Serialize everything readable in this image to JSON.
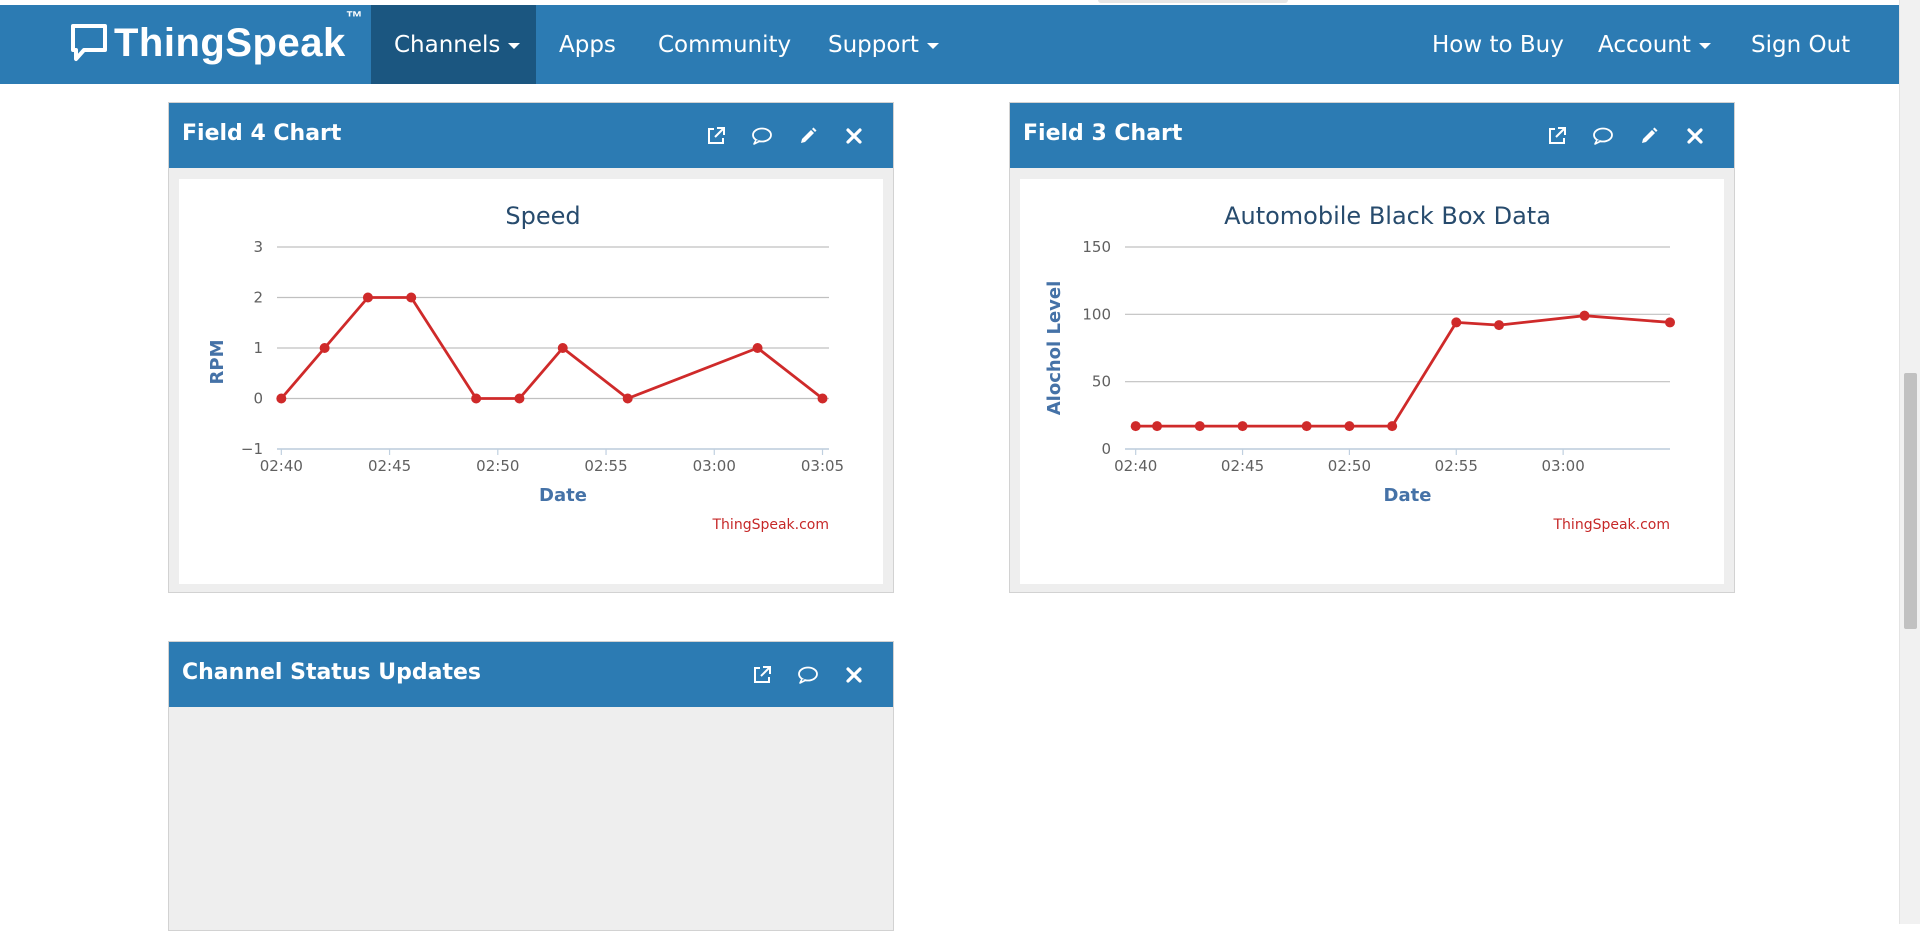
{
  "navbar": {
    "brand": "ThingSpeak",
    "brand_tm": "™",
    "items": [
      {
        "label": "Channels",
        "dropdown": true,
        "active": true
      },
      {
        "label": "Apps"
      },
      {
        "label": "Community"
      },
      {
        "label": "Support",
        "dropdown": true
      },
      {
        "label": "How to Buy"
      },
      {
        "label": "Account",
        "dropdown": true
      },
      {
        "label": "Sign Out"
      }
    ]
  },
  "panels": {
    "field4": {
      "title": "Field 4 Chart",
      "icons": [
        "external-link-icon",
        "comment-icon",
        "pencil-icon",
        "close-icon"
      ]
    },
    "field3": {
      "title": "Field 3 Chart",
      "icons": [
        "external-link-icon",
        "comment-icon",
        "pencil-icon",
        "close-icon"
      ]
    },
    "status": {
      "title": "Channel Status Updates",
      "icons": [
        "external-link-icon",
        "comment-icon",
        "close-icon"
      ]
    }
  },
  "colors": {
    "navbar": "#2c7bb3",
    "navbar_active": "#1b5680",
    "series": "#cf2a2a",
    "axis_title": "#4572a7",
    "chart_title": "#274b6d",
    "credit": "#c62828"
  },
  "chart_data": [
    {
      "type": "line",
      "title": "Speed",
      "xlabel": "Date",
      "ylabel": "RPM",
      "credit": "ThingSpeak.com",
      "x_ticks": [
        "02:40",
        "02:45",
        "02:50",
        "02:55",
        "03:00",
        "03:05"
      ],
      "y_ticks": [
        "-1",
        "0",
        "1",
        "2",
        "3"
      ],
      "ylim": [
        -1,
        3
      ],
      "xlim": [
        "02:39.8",
        "03:05.3"
      ],
      "grid": true,
      "series": [
        {
          "x": [
            "02:40",
            "02:42",
            "02:44",
            "02:46",
            "02:49",
            "02:51",
            "02:53",
            "02:56",
            "03:02",
            "03:05"
          ],
          "values": [
            0,
            1,
            2,
            2,
            0,
            0,
            1,
            0,
            1,
            0
          ]
        }
      ]
    },
    {
      "type": "line",
      "title": "Automobile Black Box Data",
      "xlabel": "Date",
      "ylabel": "Alochol Level",
      "credit": "ThingSpeak.com",
      "x_ticks": [
        "02:40",
        "02:45",
        "02:50",
        "02:55",
        "03:00"
      ],
      "y_ticks": [
        "0",
        "50",
        "100",
        "150"
      ],
      "ylim": [
        0,
        150
      ],
      "xlim": [
        "02:39.5",
        "03:05"
      ],
      "grid": true,
      "series": [
        {
          "x": [
            "02:40",
            "02:41",
            "02:43",
            "02:45",
            "02:48",
            "02:50",
            "02:52",
            "02:55",
            "02:57",
            "03:01",
            "03:05"
          ],
          "values": [
            17,
            17,
            17,
            17,
            17,
            17,
            17,
            94,
            92,
            99,
            94
          ]
        }
      ]
    }
  ]
}
